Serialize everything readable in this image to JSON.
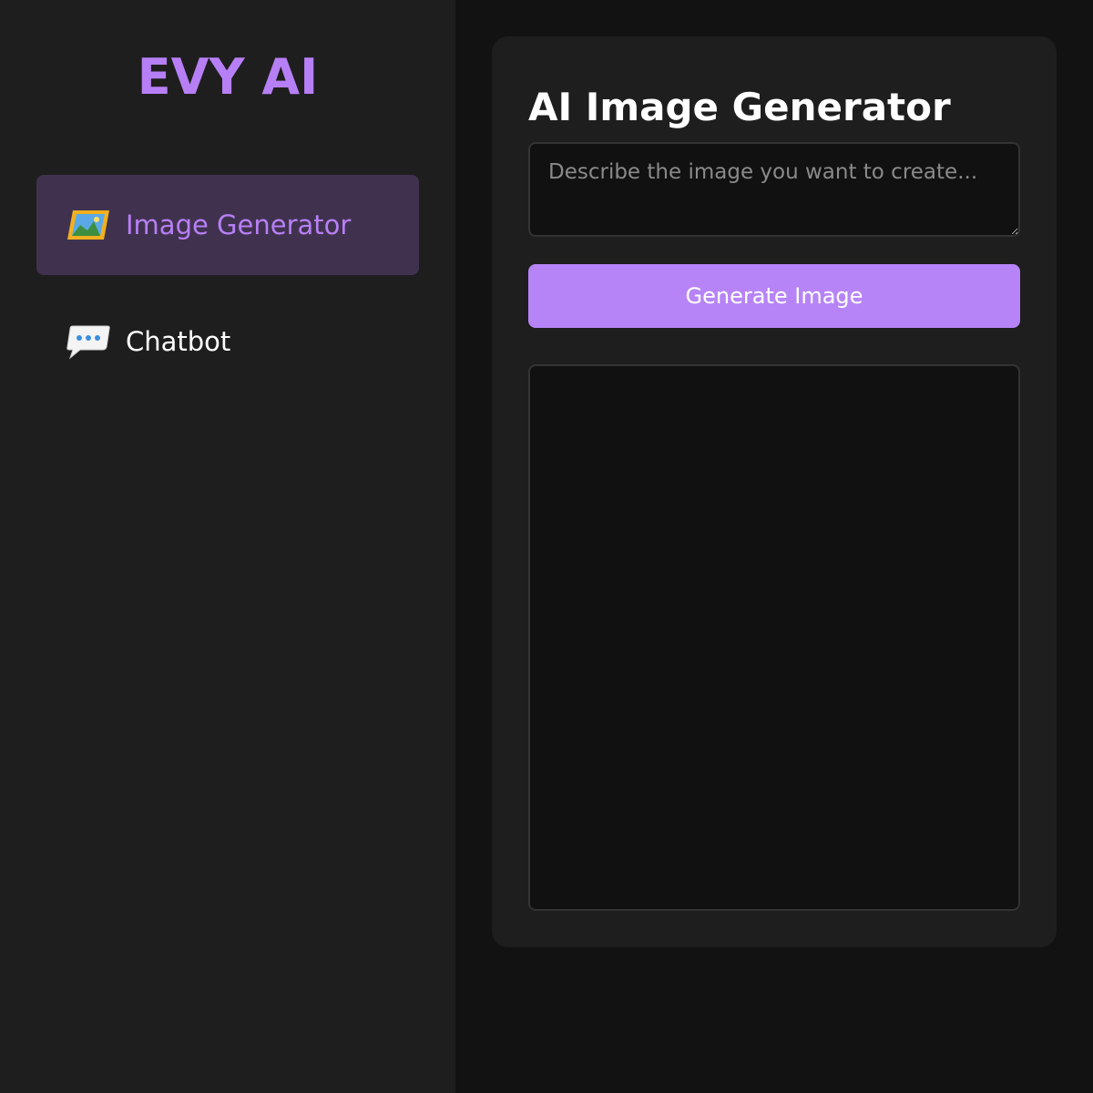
{
  "sidebar": {
    "brand": "EVY AI",
    "items": [
      {
        "label": "Image Generator",
        "icon": "framed-picture-icon",
        "active": true
      },
      {
        "label": "Chatbot",
        "icon": "speech-bubble-icon",
        "active": false
      }
    ]
  },
  "main": {
    "title": "AI Image Generator",
    "prompt": {
      "value": "",
      "placeholder": "Describe the image you want to create..."
    },
    "generate_label": "Generate Image"
  },
  "colors": {
    "accent": "#b77ff5",
    "button": "#b784f7",
    "active_item_bg": "#40324f",
    "sidebar_bg": "#1e1e1e",
    "page_bg": "#121212"
  }
}
